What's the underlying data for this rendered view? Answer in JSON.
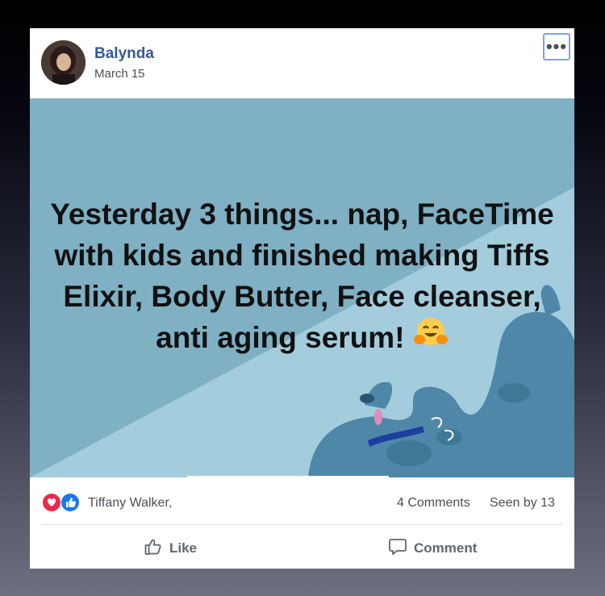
{
  "post": {
    "author": "Balynda",
    "date": "March 15",
    "more_label": "•••",
    "banner_text": "Yesterday 3 things... nap, FaceTime with kids and finished making Tiffs Elixir, Body Butter, Face cleanser, anti aging serum!",
    "banner_emoji": "hugging-face-emoji"
  },
  "stats": {
    "reactions": [
      "love",
      "like"
    ],
    "reactor_name": "Tiffany Walker,",
    "comments": "4 Comments",
    "seen": "Seen by 13"
  },
  "actions": {
    "like_label": "Like",
    "comment_label": "Comment"
  },
  "colors": {
    "author_link": "#365899",
    "banner_bg": "#7fb0c3",
    "banner_light": "#a3ccdc",
    "focus_ring": "#7ea2e8",
    "love_red": "#f0284a",
    "like_blue": "#1877f2"
  }
}
